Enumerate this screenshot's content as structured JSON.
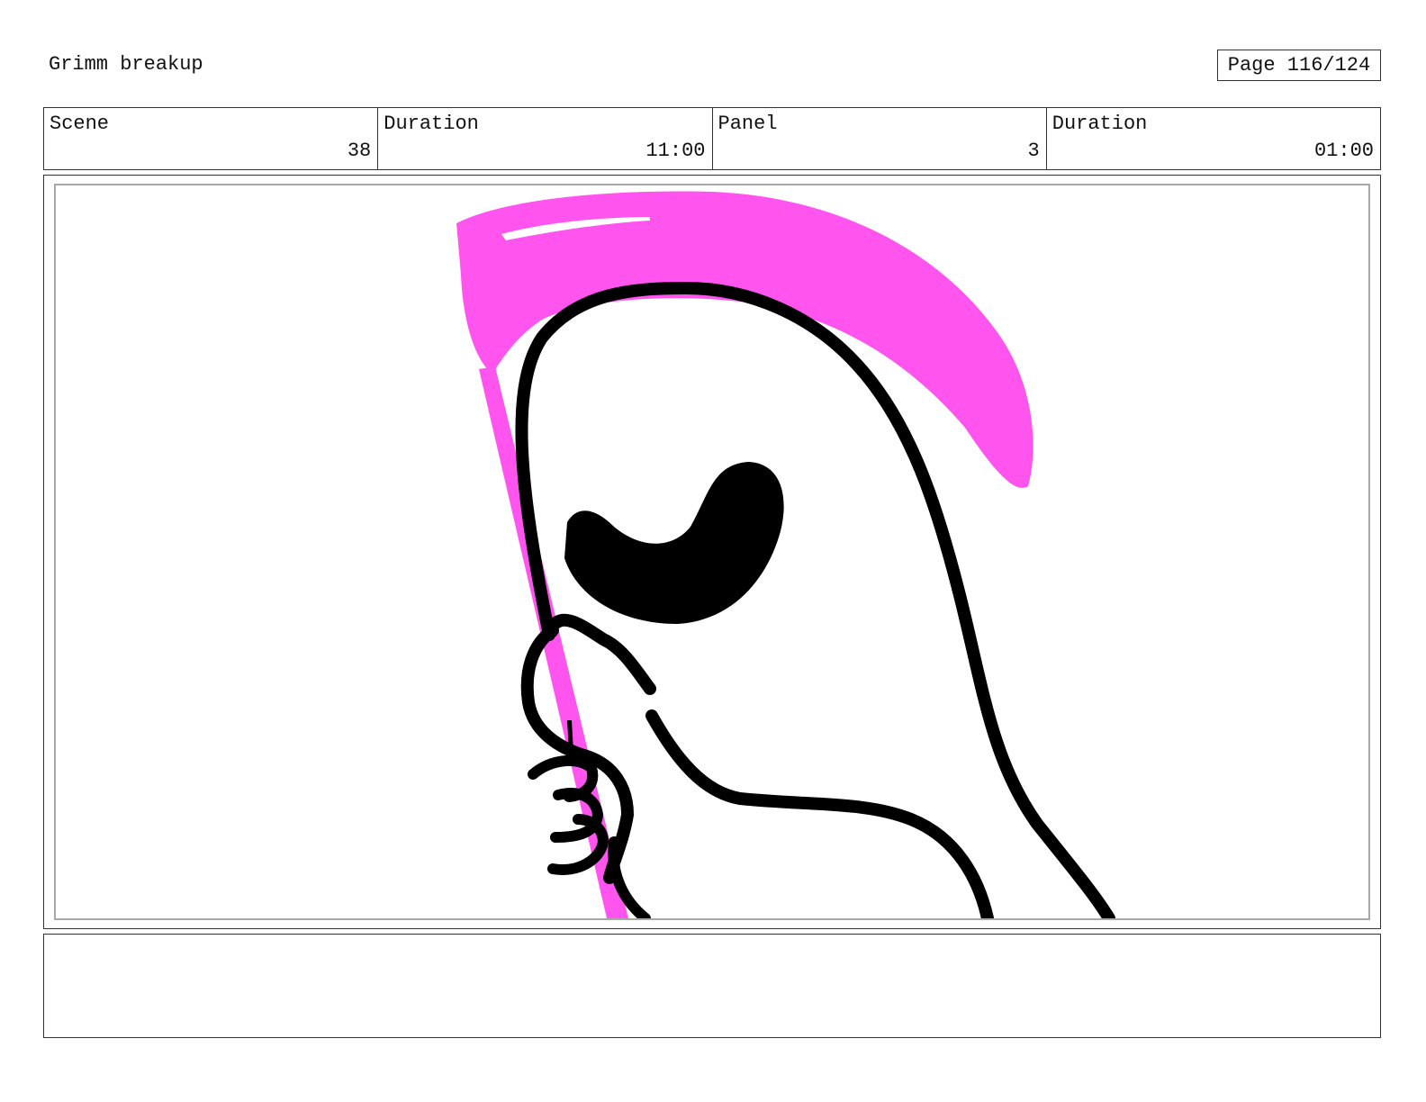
{
  "document": {
    "title": "Grimm breakup",
    "page_label": "Page 116/124"
  },
  "info": {
    "scene_label": "Scene",
    "scene_value": "38",
    "scene_duration_label": "Duration",
    "scene_duration_value": "11:00",
    "panel_label": "Panel",
    "panel_value": "3",
    "panel_duration_label": "Duration",
    "panel_duration_value": "01:00"
  },
  "artwork": {
    "subject": "grim-reaper-with-scythe",
    "colors": {
      "scythe": "#ff55ee",
      "ink": "#000000"
    }
  },
  "notes": {
    "text": ""
  }
}
